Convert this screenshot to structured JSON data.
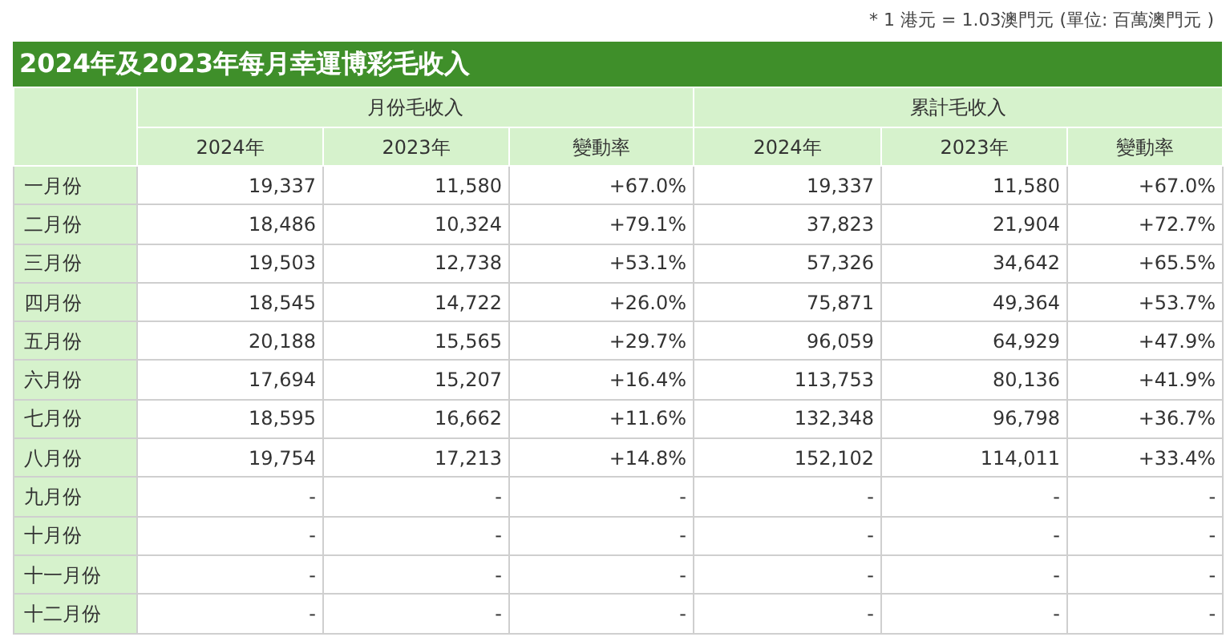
{
  "note": "* 1 港元 = 1.03澳門元 (單位: 百萬澳門元 )",
  "title": "2024年及2023年每月幸運博彩毛收入",
  "column_groups": [
    "月份毛收入",
    "累計毛收入"
  ],
  "columns": [
    "2024年",
    "2023年",
    "變動率",
    "2024年",
    "2023年",
    "變動率"
  ],
  "rows": [
    {
      "month": "一月份",
      "cells": [
        "19,337",
        "11,580",
        "+67.0%",
        "19,337",
        "11,580",
        "+67.0%"
      ]
    },
    {
      "month": "二月份",
      "cells": [
        "18,486",
        "10,324",
        "+79.1%",
        "37,823",
        "21,904",
        "+72.7%"
      ]
    },
    {
      "month": "三月份",
      "cells": [
        "19,503",
        "12,738",
        "+53.1%",
        "57,326",
        "34,642",
        "+65.5%"
      ]
    },
    {
      "month": "四月份",
      "cells": [
        "18,545",
        "14,722",
        "+26.0%",
        "75,871",
        "49,364",
        "+53.7%"
      ]
    },
    {
      "month": "五月份",
      "cells": [
        "20,188",
        "15,565",
        "+29.7%",
        "96,059",
        "64,929",
        "+47.9%"
      ]
    },
    {
      "month": "六月份",
      "cells": [
        "17,694",
        "15,207",
        "+16.4%",
        "113,753",
        "80,136",
        "+41.9%"
      ]
    },
    {
      "month": "七月份",
      "cells": [
        "18,595",
        "16,662",
        "+11.6%",
        "132,348",
        "96,798",
        "+36.7%"
      ]
    },
    {
      "month": "八月份",
      "cells": [
        "19,754",
        "17,213",
        "+14.8%",
        "152,102",
        "114,011",
        "+33.4%"
      ]
    },
    {
      "month": "九月份",
      "cells": [
        "-",
        "-",
        "-",
        "-",
        "-",
        "-"
      ]
    },
    {
      "month": "十月份",
      "cells": [
        "-",
        "-",
        "-",
        "-",
        "-",
        "-"
      ]
    },
    {
      "month": "十一月份",
      "cells": [
        "-",
        "-",
        "-",
        "-",
        "-",
        "-"
      ]
    },
    {
      "month": "十二月份",
      "cells": [
        "-",
        "-",
        "-",
        "-",
        "-",
        "-"
      ]
    }
  ]
}
